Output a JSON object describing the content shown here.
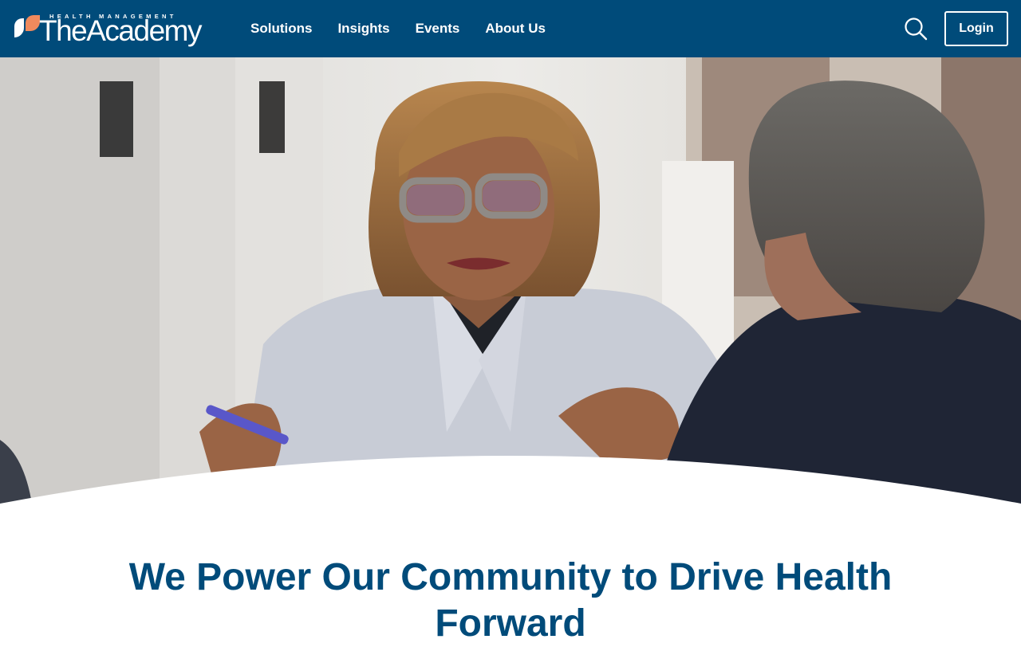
{
  "header": {
    "logo": {
      "tagline": "HEALTH MANAGEMENT",
      "wordmark": "TheAcademy",
      "mark_icon": "academy-logo-mark"
    },
    "nav": [
      {
        "label": "Solutions"
      },
      {
        "label": "Insights"
      },
      {
        "label": "Events"
      },
      {
        "label": "About Us"
      }
    ],
    "search_icon": "search-icon",
    "login_label": "Login"
  },
  "hero": {
    "image": "photo of a woman in glasses and a light patterned jacket gesturing while talking to a man seen from behind"
  },
  "main": {
    "headline": "We Power Our Community to Drive Health Forward"
  },
  "colors": {
    "header_bg": "#004b7a",
    "accent_orange": "#f08a5d",
    "headline_text": "#004b7a",
    "button_border": "#ffffff"
  }
}
